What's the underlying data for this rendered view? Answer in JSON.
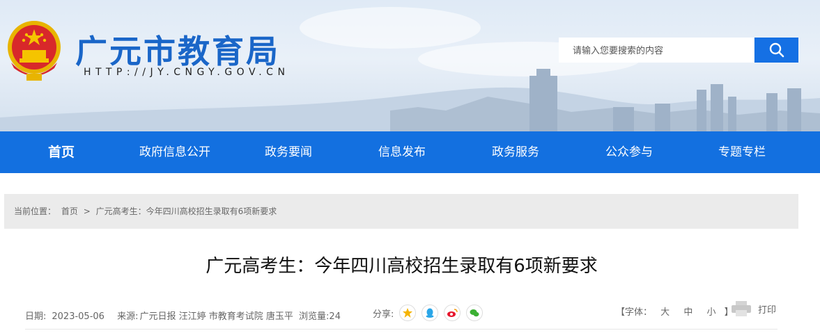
{
  "header": {
    "site_title": "广元市教育局",
    "site_url": "HTTP://JY.CNGY.GOV.CN"
  },
  "search": {
    "placeholder": "请输入您要搜索的内容"
  },
  "nav": {
    "items": [
      {
        "label": "首页",
        "active": true
      },
      {
        "label": "政府信息公开"
      },
      {
        "label": "政务要闻"
      },
      {
        "label": "信息发布"
      },
      {
        "label": "政务服务"
      },
      {
        "label": "公众参与"
      },
      {
        "label": "专题专栏"
      }
    ]
  },
  "breadcrumb": {
    "prefix": "当前位置：",
    "home": "首页",
    "separator": ">",
    "current": "广元高考生：今年四川高校招生录取有6项新要求"
  },
  "article": {
    "title": "广元高考生：今年四川高校招生录取有6项新要求",
    "date_label": "日期:",
    "date": "2023-05-06",
    "source_label": "来源:",
    "source": "广元日报 汪江婷 市教育考试院 唐玉平",
    "views_label": "浏览量:",
    "views": "24"
  },
  "share": {
    "label": "分享:",
    "icons": [
      "qzone-icon",
      "qq-icon",
      "weibo-icon",
      "wechat-icon"
    ]
  },
  "font_size": {
    "open": "【字体：",
    "large": "大",
    "medium": "中",
    "small": "小",
    "close": "】"
  },
  "print": {
    "label": "打印"
  },
  "colors": {
    "primary": "#1370e0",
    "title_blue": "#1a66c8",
    "breadcrumb_bg": "#ebebeb"
  }
}
